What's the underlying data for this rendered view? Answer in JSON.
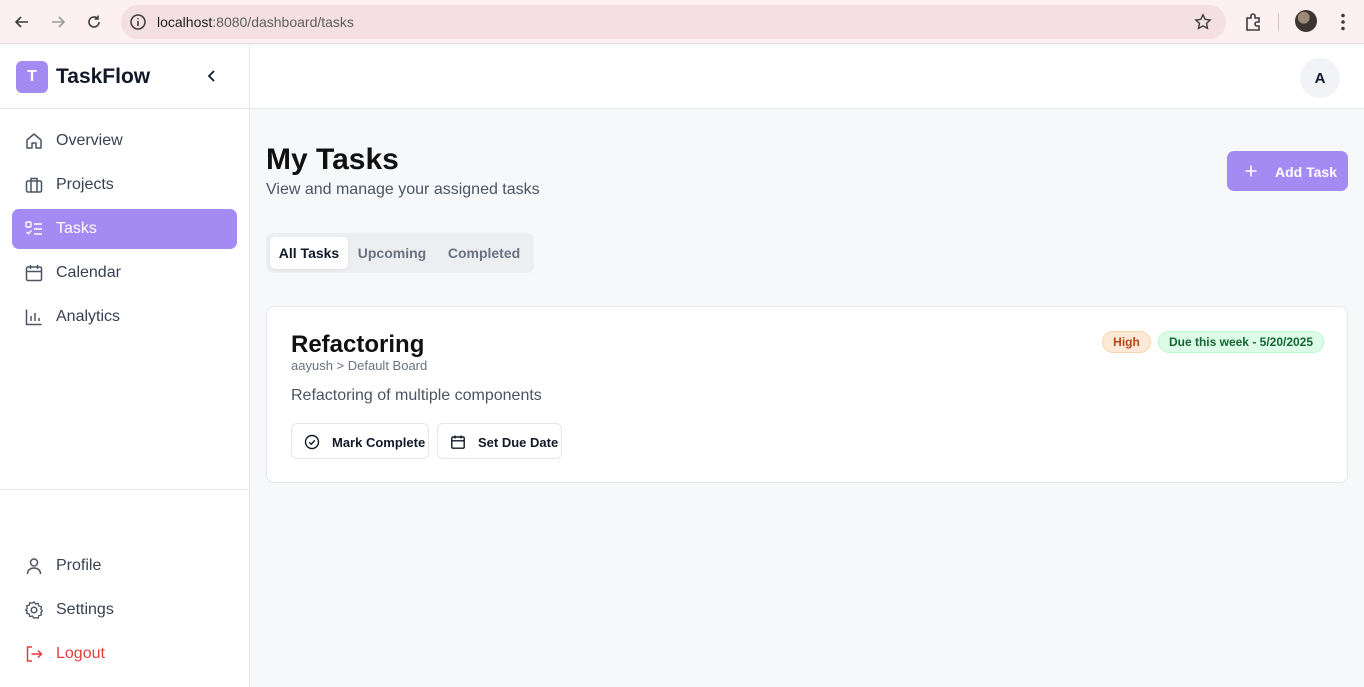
{
  "browser": {
    "url_host": "localhost",
    "url_rest": ":8080/dashboard/tasks"
  },
  "sidebar": {
    "logo_letter": "T",
    "brand": "TaskFlow",
    "items": [
      {
        "label": "Overview",
        "icon": "home-icon"
      },
      {
        "label": "Projects",
        "icon": "briefcase-icon"
      },
      {
        "label": "Tasks",
        "icon": "checklist-icon",
        "active": true
      },
      {
        "label": "Calendar",
        "icon": "calendar-icon"
      },
      {
        "label": "Analytics",
        "icon": "bar-chart-icon"
      }
    ],
    "footer_items": [
      {
        "label": "Profile",
        "icon": "user-icon"
      },
      {
        "label": "Settings",
        "icon": "gear-icon"
      },
      {
        "label": "Logout",
        "icon": "logout-icon"
      }
    ],
    "accent_color": "#a48af3"
  },
  "topbar": {
    "avatar_initial": "A"
  },
  "main": {
    "title": "My Tasks",
    "subtitle": "View and manage your assigned tasks",
    "add_button": "Add Task",
    "tabs": [
      {
        "label": "All Tasks",
        "active": true
      },
      {
        "label": "Upcoming"
      },
      {
        "label": "Completed"
      }
    ]
  },
  "task": {
    "title": "Refactoring",
    "path": "aayush > Default Board",
    "description": "Refactoring of multiple components",
    "priority": "High",
    "due": "Due this week - 5/20/2025",
    "mark_complete": "Mark Complete",
    "set_due_date": "Set Due Date"
  }
}
